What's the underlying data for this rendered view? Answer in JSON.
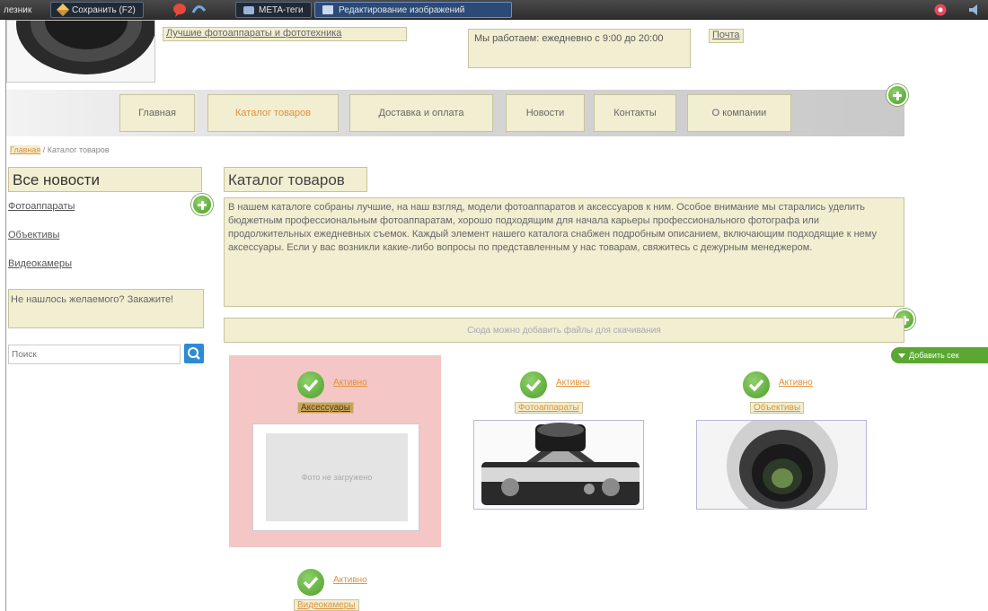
{
  "toolbar": {
    "left_label": "лезник",
    "save": "Сохранить (F2)",
    "meta_tab": "META-теги",
    "edit_tab": "Редактирование изображений"
  },
  "header": {
    "tagline": "Лучшие фотоаппараты и фототехника",
    "hours": "Мы работаем: ежедневно с 9:00 до 20:00",
    "right_link": "Почта"
  },
  "nav": [
    "Главная",
    "Каталог товаров",
    "Доставка и оплата",
    "Новости",
    "Контакты",
    "О компании"
  ],
  "breadcrumb": {
    "home": "Главная",
    "separator": " / ",
    "current": "Каталог товаров"
  },
  "sidebar": {
    "title": "Все новости",
    "links": [
      "Фотоаппараты",
      "Объективы",
      "Видеокамеры"
    ],
    "wish": "Не нашлось желаемого? Закажите!",
    "search_placeholder": "Поиск"
  },
  "main": {
    "title": "Каталог товаров",
    "description": "В нашем каталоге собраны лучшие, на наш взгляд, модели фотоаппаратов и аксессуаров к ним. Особое внимание мы старались уделить бюджетным профессиональным фотоаппаратам, хорошо подходящим для начала карьеры профессионального фотографа или продолжительных ежедневных съемок. Каждый элемент нашего каталога снабжен подробным описанием, включающим подходящие к нему аксессуары. Если у вас возникли какие-либо вопросы по представленным у нас товарам, свяжитесь с дежурным менеджером.",
    "files_hint": "Сюда можно добавить файлы для скачивания",
    "add_section": "Добавить сек"
  },
  "cards": [
    {
      "status": "Активно",
      "label": "Аксессуары",
      "placeholder": "Фото не загружено"
    },
    {
      "status": "Активно",
      "label": "Фотоаппараты"
    },
    {
      "status": "Активно",
      "label": "Объективы"
    },
    {
      "status": "Активно",
      "label": "Видеокамеры"
    }
  ],
  "colors": {
    "accent": "#e0913a",
    "editable_bg": "#f1eed2",
    "green": "#5aa832",
    "toolbar": "#3a3a3a"
  }
}
